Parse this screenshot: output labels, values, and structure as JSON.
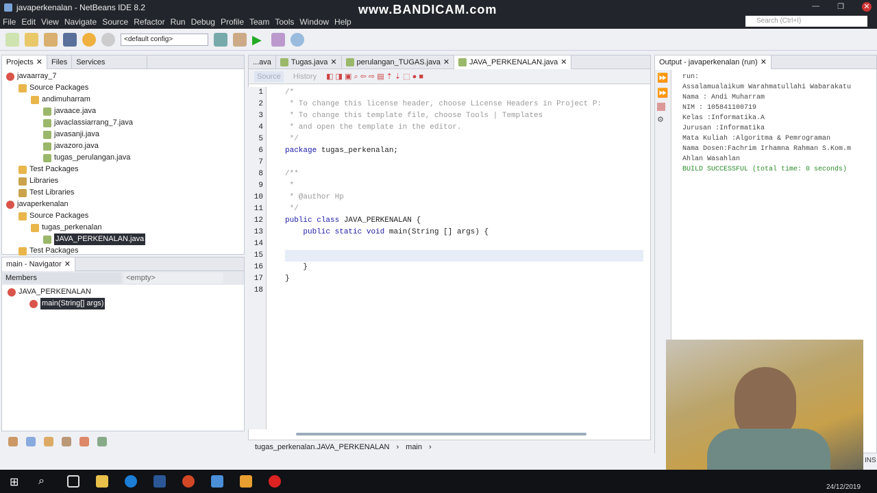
{
  "window": {
    "title": "javaperkenalan - NetBeans IDE 8.2",
    "watermark": "www.BANDICAM.com"
  },
  "menu": [
    "File",
    "Edit",
    "View",
    "Navigate",
    "Source",
    "Refactor",
    "Run",
    "Debug",
    "Profile",
    "Team",
    "Tools",
    "Window",
    "Help"
  ],
  "search": {
    "placeholder": "Search (Ctrl+I)"
  },
  "toolbar": {
    "config": "<default config>"
  },
  "projects": {
    "tabs": [
      "Projects",
      "Files",
      "Services"
    ],
    "tree": [
      {
        "label": "javaarray_7",
        "type": "proj",
        "indent": 0
      },
      {
        "label": "Source Packages",
        "type": "pkg",
        "indent": 1
      },
      {
        "label": "andimuharram",
        "type": "pkg",
        "indent": 2
      },
      {
        "label": "javaace.java",
        "type": "jf",
        "indent": 3
      },
      {
        "label": "javaclassiarrang_7.java",
        "type": "jf",
        "indent": 3
      },
      {
        "label": "javasanji.java",
        "type": "jf",
        "indent": 3
      },
      {
        "label": "javazoro.java",
        "type": "jf",
        "indent": 3
      },
      {
        "label": "tugas_perulangan.java",
        "type": "jf",
        "indent": 3
      },
      {
        "label": "Test Packages",
        "type": "pkg",
        "indent": 1
      },
      {
        "label": "Libraries",
        "type": "lib",
        "indent": 1
      },
      {
        "label": "Test Libraries",
        "type": "lib",
        "indent": 1
      },
      {
        "label": "javaperkenalan",
        "type": "proj",
        "indent": 0
      },
      {
        "label": "Source Packages",
        "type": "pkg",
        "indent": 1
      },
      {
        "label": "tugas_perkenalan",
        "type": "pkg",
        "indent": 2
      },
      {
        "label": "JAVA_PERKENALAN.java",
        "type": "jf",
        "indent": 3,
        "selected": true
      },
      {
        "label": "Test Packages",
        "type": "pkg",
        "indent": 1
      }
    ]
  },
  "navigator": {
    "title": "main - Navigator",
    "filter": "Members",
    "combo": "<empty>",
    "class": "JAVA_PERKENALAN",
    "method": "main(String[] args)"
  },
  "editor": {
    "tabs": [
      "...ava",
      "Tugas.java",
      "perulangan_TUGAS.java",
      "JAVA_PERKENALAN.java"
    ],
    "source": "Source",
    "history": "History",
    "lines": [
      {
        "n": "1",
        "t": "/*",
        "c": "cm"
      },
      {
        "n": "2",
        "t": " * To change this license header, choose License Headers in Project P:",
        "c": "cm"
      },
      {
        "n": "3",
        "t": " * To change this template file, choose Tools | Templates",
        "c": "cm"
      },
      {
        "n": "4",
        "t": " * and open the template in the editor.",
        "c": "cm"
      },
      {
        "n": "5",
        "t": " */",
        "c": "cm"
      },
      {
        "n": "6",
        "t": "package tugas_perkenalan;",
        "c": ""
      },
      {
        "n": "7",
        "t": "",
        "c": ""
      },
      {
        "n": "8",
        "t": "/**",
        "c": "cm"
      },
      {
        "n": "9",
        "t": " *",
        "c": "cm"
      },
      {
        "n": "10",
        "t": " * @author Hp",
        "c": "cm"
      },
      {
        "n": "11",
        "t": " */",
        "c": "cm"
      },
      {
        "n": "12",
        "t": "public class JAVA_PERKENALAN {",
        "c": ""
      },
      {
        "n": "13",
        "t": "    public static void main(String [] args) {",
        "c": ""
      },
      {
        "n": "14",
        "t": "",
        "c": ""
      },
      {
        "n": "15",
        "t": "",
        "c": "cur"
      },
      {
        "n": "16",
        "t": "    }",
        "c": ""
      },
      {
        "n": "17",
        "t": "}",
        "c": ""
      },
      {
        "n": "18",
        "t": "",
        "c": ""
      }
    ],
    "breadcrumb": [
      "tugas_perkenalan.JAVA_PERKENALAN",
      "main"
    ]
  },
  "output": {
    "title": "Output - javaperkenalan (run)",
    "lines": [
      "run:",
      "Assalamualaikum Warahmatullahi Wabarakatu",
      "Nama : Andi Muharram",
      "NIM : 105841100719",
      "Kelas :Informatika.A",
      "Jurusan :Informatika",
      "Mata Kuliah :Algoritma & Pemrograman",
      "Nama Dosen:Fachrim Irhamna Rahman S.Kom.m",
      "Ahlan Wasahlan"
    ],
    "success": "BUILD SUCCESSFUL (total time: 0 seconds)"
  },
  "status": {
    "ins": "INS",
    "date": "24/12/2019"
  }
}
